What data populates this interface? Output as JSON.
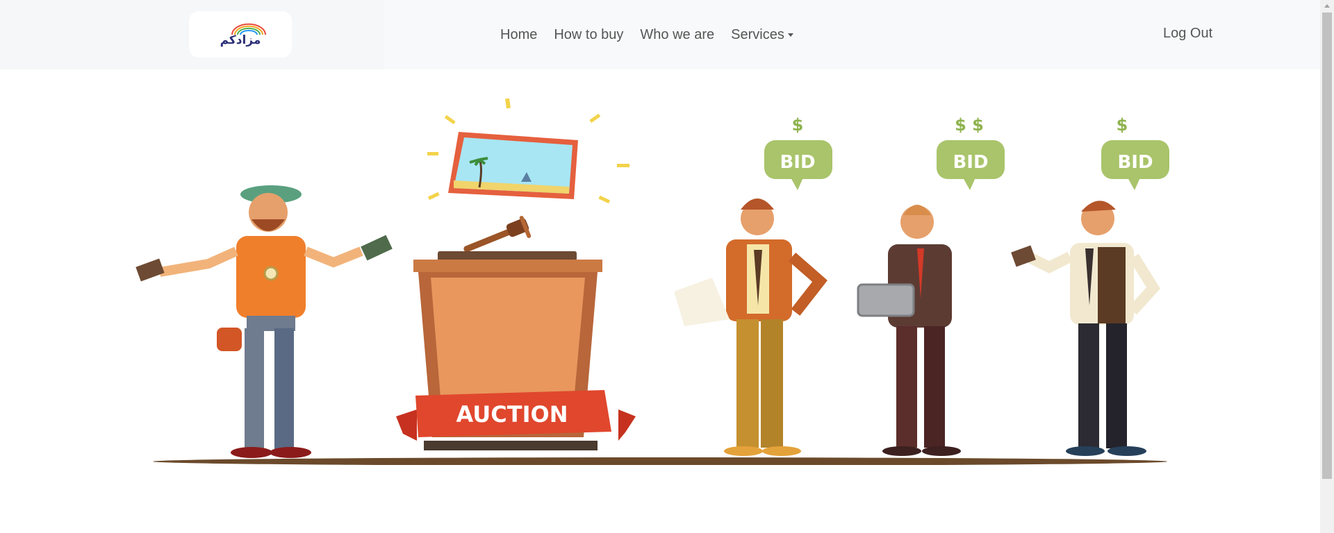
{
  "header": {
    "logo_text": "مزادكم",
    "nav": [
      {
        "label": "Home"
      },
      {
        "label": "How to buy"
      },
      {
        "label": "Who we are"
      },
      {
        "label": "Services",
        "has_dropdown": true
      }
    ],
    "logout_label": "Log Out"
  },
  "hero": {
    "podium_banner": "AUCTION",
    "bid_bubbles": [
      "BID",
      "BID",
      "BID"
    ],
    "bubble_symbols": [
      "$",
      "$ $",
      "$"
    ]
  },
  "colors": {
    "navbar_bg": "#f8f9fa",
    "nav_text": "#555555",
    "bid_green": "#a9c46a",
    "banner_red": "#e0472d",
    "podium_orange": "#e9975d"
  }
}
